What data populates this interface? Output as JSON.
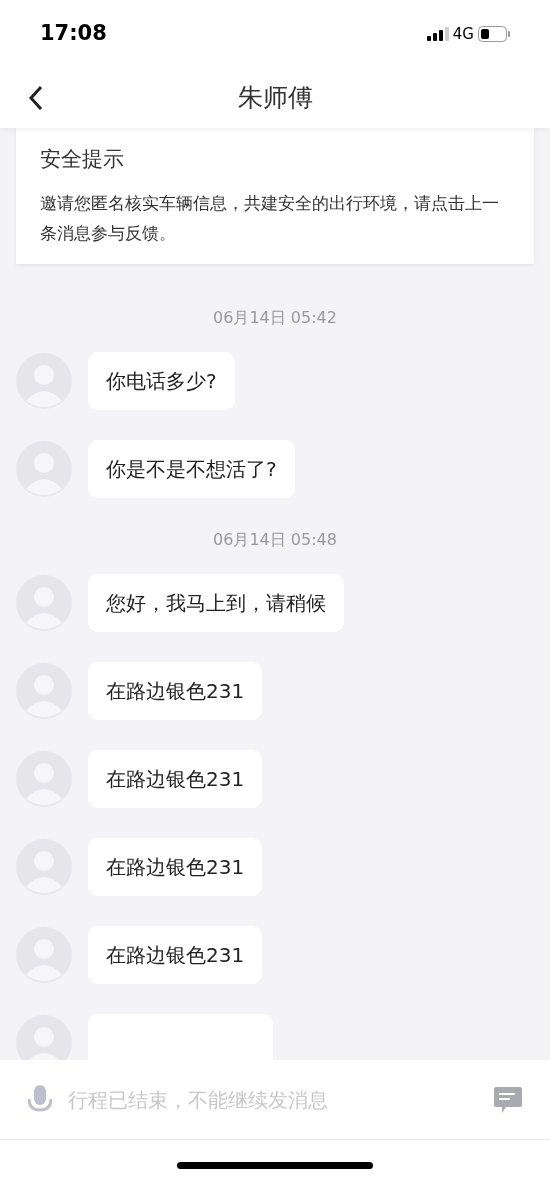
{
  "status_bar": {
    "time": "17:08",
    "network": "4G"
  },
  "header": {
    "title": "朱师傅"
  },
  "notice": {
    "title": "安全提示",
    "body": "邀请您匿名核实车辆信息，共建安全的出行环境，请点击上一条消息参与反馈。"
  },
  "chat": [
    {
      "kind": "time",
      "text": "06月14日 05:42"
    },
    {
      "kind": "message",
      "text": "你电话多少?"
    },
    {
      "kind": "message",
      "text": "你是不是不想活了?"
    },
    {
      "kind": "time",
      "text": "06月14日 05:48"
    },
    {
      "kind": "message",
      "text": "您好，我马上到，请稍候"
    },
    {
      "kind": "message",
      "text": "在路边银色231"
    },
    {
      "kind": "message",
      "text": "在路边银色231"
    },
    {
      "kind": "message",
      "text": "在路边银色231"
    },
    {
      "kind": "message",
      "text": "在路边银色231"
    },
    {
      "kind": "cut"
    }
  ],
  "input_bar": {
    "placeholder": "行程已结束，不能继续发消息",
    "disabled": true
  }
}
